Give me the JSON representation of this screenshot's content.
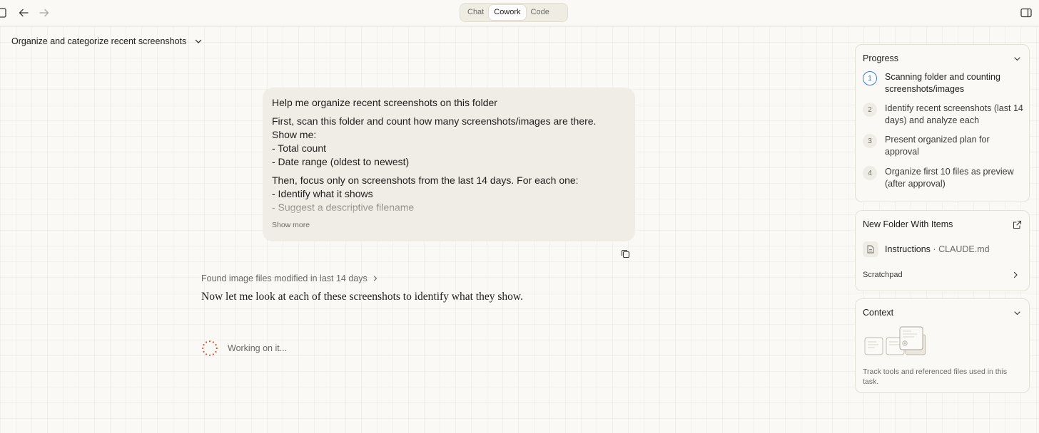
{
  "topbar": {
    "tabs": [
      {
        "label": "Chat",
        "active": false
      },
      {
        "label": "Cowork",
        "active": true
      },
      {
        "label": "Code",
        "active": false
      }
    ],
    "icons": [
      "sidebar-toggle-icon",
      "arrow-left-icon",
      "arrow-right-icon",
      "panel-toggle-icon"
    ]
  },
  "task": {
    "title": "Organize and categorize recent screenshots"
  },
  "user_message": {
    "title_line": "Help me organize recent screenshots on this folder",
    "para1": [
      "First, scan this folder and count how many screenshots/images are there.",
      "Show me:",
      "- Total count",
      "- Date range (oldest to newest)"
    ],
    "para2": [
      "Then, focus only on screenshots from the last 14 days. For each one:",
      "- Identify what it shows",
      "- Suggest a descriptive filename"
    ],
    "show_more": "Show more"
  },
  "assistant": {
    "tool_summary": "Found image files modified in last 14 days",
    "text": "Now let me look at each of these screenshots to identify what they show.",
    "status": "Working on it..."
  },
  "panels": {
    "progress": {
      "title": "Progress",
      "steps": [
        {
          "num": "1",
          "text": "Scanning folder and counting screenshots/images",
          "active": true
        },
        {
          "num": "2",
          "text": "Identify recent screenshots (last 14 days) and analyze each",
          "active": false
        },
        {
          "num": "3",
          "text": "Present organized plan for approval",
          "active": false
        },
        {
          "num": "4",
          "text": "Organize first 10 files as preview (after approval)",
          "active": false
        }
      ]
    },
    "folder": {
      "title": "New Folder With Items",
      "file_label": "Instructions",
      "file_sep": "·",
      "file_name": "CLAUDE.md",
      "scratchpad": "Scratchpad"
    },
    "context": {
      "title": "Context",
      "description": "Track tools and referenced files used in this task."
    }
  },
  "colors": {
    "background": "#faf9f5",
    "user_bubble": "#f0ede6",
    "active_step": "#3a7be0",
    "spinner": "#c9573a"
  }
}
